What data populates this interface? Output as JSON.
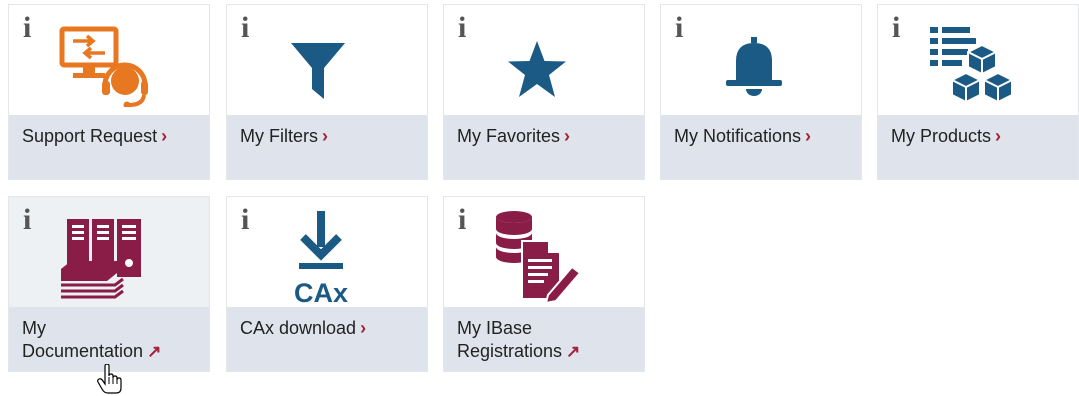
{
  "tiles": [
    {
      "label": "Support Request",
      "link": "chevron",
      "icon": "support-request-icon",
      "color": "#e87722"
    },
    {
      "label": "My Filters",
      "link": "chevron",
      "icon": "filter-icon",
      "color": "#1a5a84"
    },
    {
      "label": "My Favorites",
      "link": "chevron",
      "icon": "star-icon",
      "color": "#1a5a84"
    },
    {
      "label": "My Notifications",
      "link": "chevron",
      "icon": "bell-icon",
      "color": "#1a5a84"
    },
    {
      "label": "My Products",
      "link": "chevron",
      "icon": "products-icon",
      "color": "#1a5a84"
    },
    {
      "label_line1": "My",
      "label_line2": "Documentation",
      "link": "external",
      "icon": "documentation-icon",
      "color": "#8a1c48"
    },
    {
      "label": "CAx download",
      "link": "chevron",
      "icon": "cax-download-icon",
      "icon_text": "CAx",
      "color": "#1a5a84"
    },
    {
      "label_line1": "My IBase",
      "label_line2": "Registrations",
      "link": "external",
      "icon": "ibase-registrations-icon",
      "color": "#8a1c48"
    }
  ],
  "info_glyph": "i",
  "chevron_glyph": "›",
  "external_glyph": "↗",
  "accent_color": "#a2233a"
}
